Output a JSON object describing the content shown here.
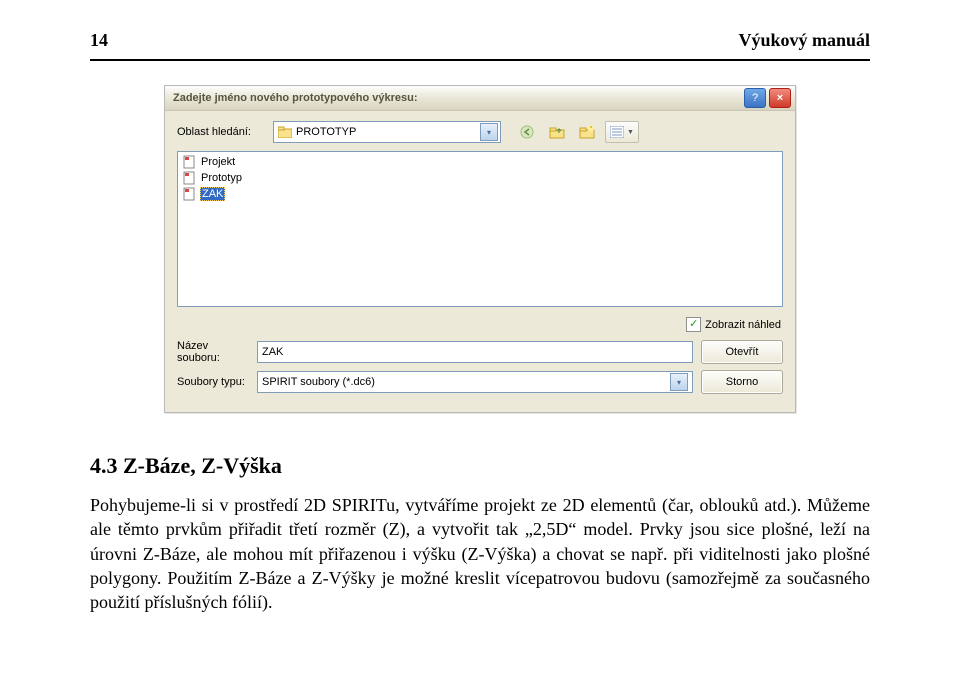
{
  "header": {
    "page_number": "14",
    "title": "Výukový manuál"
  },
  "dialog": {
    "title": "Zadejte jméno nového prototypového výkresu:",
    "search_label": "Oblast hledání:",
    "folder_name": "PROTOTYP",
    "files": [
      {
        "name": "Projekt",
        "selected": false
      },
      {
        "name": "Prototyp",
        "selected": false
      },
      {
        "name": "ZAK",
        "selected": true
      }
    ],
    "preview_checkbox": "Zobrazit náhled",
    "filename_label": "Název souboru:",
    "filename_value": "ZAK",
    "filetype_label": "Soubory typu:",
    "filetype_value": "SPIRIT soubory (*.dc6)",
    "open_button": "Otevřít",
    "cancel_button": "Storno"
  },
  "section": {
    "heading": "4.3   Z-Báze, Z-Výška",
    "paragraph": "Pohybujeme-li si  v prostředí 2D SPIRITu, vytváříme projekt ze 2D elementů (čar, oblouků atd.). Můžeme ale těmto prvkům přiřadit třetí rozměr (Z), a vytvořit tak „2,5D“ model. Prvky jsou sice plošné, leží na úrovni Z-Báze, ale mohou mít přiřazenou i výšku (Z-Výška) a chovat se např. při viditelnosti jako plošné polygony. Použitím Z-Báze a Z-Výšky je možné kreslit vícepatrovou budovu (samozřejmě za současného použití příslušných fólií)."
  }
}
